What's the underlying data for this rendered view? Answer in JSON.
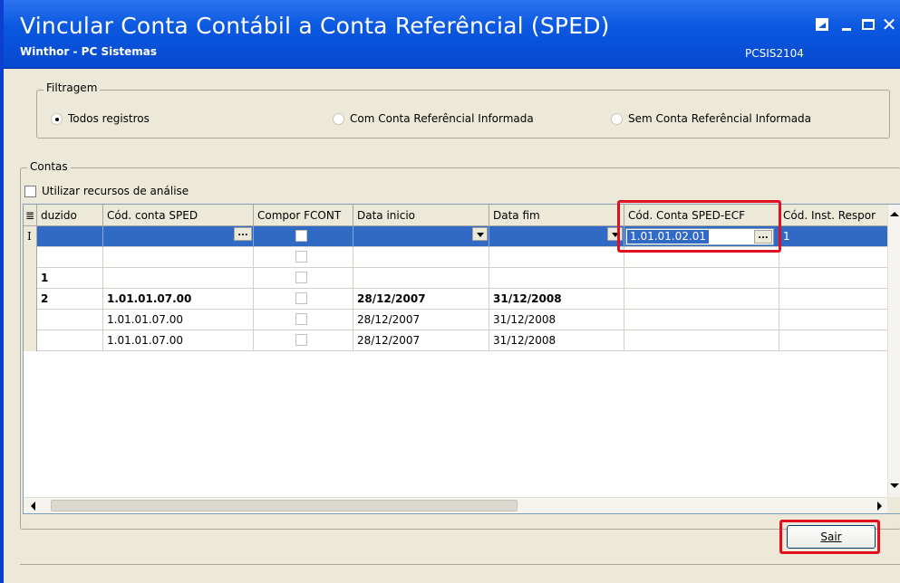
{
  "window": {
    "title": "Vincular Conta Contábil a Conta Referêncial (SPED)",
    "subtitle": "Winthor - PC Sistemas",
    "code": "PCSIS2104",
    "close_glyph": "✕"
  },
  "filter": {
    "label": "Filtragem",
    "options": [
      {
        "label": "Todos registros",
        "selected": true
      },
      {
        "label": "Com Conta Referêncial Informada",
        "selected": false
      },
      {
        "label": "Sem Conta Referêncial Informada",
        "selected": false
      }
    ]
  },
  "contas": {
    "label": "Contas",
    "analise_label": "Utilizar recursos de análise"
  },
  "grid": {
    "headers": [
      "duzido",
      "Cód. conta SPED",
      "Compor FCONT",
      "Data inicio",
      "Data fim",
      "Cód. Conta SPED-ECF",
      "Cód. Inst. Respor"
    ],
    "rows": [
      {
        "id": "",
        "conta": "",
        "ini": "",
        "fim": "",
        "ecf": "1.01.01.02.01",
        "bold": false
      },
      {
        "id": "",
        "conta": "",
        "ini": "",
        "fim": "",
        "ecf": "",
        "bold": false
      },
      {
        "id": "1",
        "conta": "",
        "ini": "",
        "fim": "",
        "ecf": "",
        "bold": true
      },
      {
        "id": "2",
        "conta": "1.01.01.07.00",
        "ini": "28/12/2007",
        "fim": "31/12/2008",
        "ecf": "",
        "bold": true
      },
      {
        "id": "",
        "conta": "1.01.01.07.00",
        "ini": "28/12/2007",
        "fim": "31/12/2008",
        "ecf": "",
        "bold": false
      },
      {
        "id": "",
        "conta": "1.01.01.07.00",
        "ini": "28/12/2007",
        "fim": "31/12/2008",
        "ecf": "",
        "bold": false
      }
    ],
    "ellipsis": "...",
    "editing_glyph": "I",
    "last_cell_glyph": "1"
  },
  "buttons": {
    "sair": "Sair"
  },
  "colors": {
    "selection": "#316ac5",
    "highlight": "#e0101e",
    "titlebar": "#0a58e0"
  }
}
